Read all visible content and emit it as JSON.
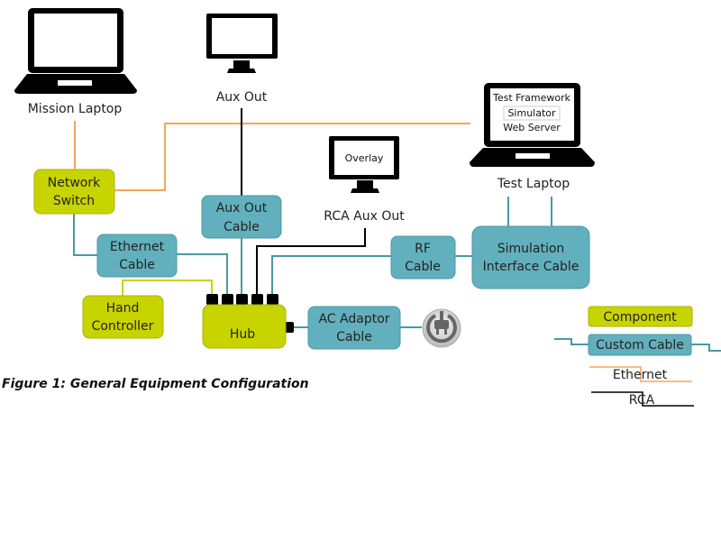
{
  "colors": {
    "component": "#c8d400",
    "component_border": "#a8b300",
    "cable": "#62b0bd",
    "cable_border": "#4a98a6",
    "ethernet_line": "#f5a65b",
    "cable_line": "#4a98a6",
    "rca_line": "#000000",
    "hand_line": "#c8d400"
  },
  "devices": {
    "mission_laptop": "Mission Laptop",
    "aux_out": "Aux Out",
    "rca_aux_out": "RCA Aux Out",
    "overlay_screen": "Overlay",
    "test_laptop": "Test Laptop",
    "test_laptop_screen": [
      "Test Framework",
      "Simulator",
      "Web Server"
    ]
  },
  "components": {
    "network_switch": [
      "Network",
      "Switch"
    ],
    "hand_controller": [
      "Hand",
      "Controller"
    ],
    "hub": "Hub"
  },
  "cables": {
    "ethernet_cable": [
      "Ethernet",
      "Cable"
    ],
    "aux_out_cable": [
      "Aux Out",
      "Cable"
    ],
    "rf_cable": [
      "RF",
      "Cable"
    ],
    "simulation_interface_cable": [
      "Simulation",
      "Interface Cable"
    ],
    "ac_adaptor_cable": [
      "AC Adaptor",
      "Cable"
    ]
  },
  "icons": {
    "power_plug": "power-plug-icon"
  },
  "legend": {
    "component": "Component",
    "custom_cable": "Custom Cable",
    "ethernet": "Ethernet",
    "rca": "RCA"
  },
  "caption": "Figure 1: General Equipment Configuration"
}
